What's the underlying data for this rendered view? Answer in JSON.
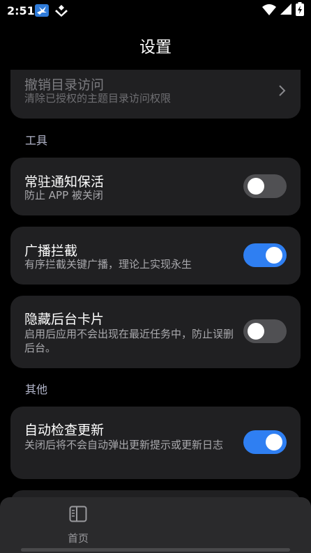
{
  "status_bar": {
    "time": "2:51"
  },
  "header": {
    "title": "设置"
  },
  "items": {
    "revoke": {
      "title": "撤销目录访问",
      "desc": "清除已授权的主题目录访问权限"
    },
    "keep_alive": {
      "title": "常驻通知保活",
      "desc": "防止 APP 被关闭",
      "enabled": false
    },
    "broadcast": {
      "title": "广播拦截",
      "desc": "有序拦截关键广播，理论上实现永生",
      "enabled": true
    },
    "hide_recents": {
      "title": "隐藏后台卡片",
      "desc": "启用后应用不会出现在最近任务中，防止误删后台。",
      "enabled": false
    },
    "auto_update": {
      "title": "自动检查更新",
      "desc": "关闭后将不会自动弹出更新提示或更新日志",
      "enabled": true
    }
  },
  "sections": {
    "tools": "工具",
    "other": "其他"
  },
  "bottom_nav": {
    "home_label": "首页"
  },
  "colors": {
    "background": "#000000",
    "card": "#202022",
    "accent": "#2f7ff2",
    "toggle_off": "#505053"
  },
  "icons": [
    "bird-notification-icon",
    "diamond-notification-icon",
    "wifi-icon",
    "cellular-signal-icon",
    "battery-charging-icon",
    "chevron-right-icon",
    "book-icon"
  ]
}
